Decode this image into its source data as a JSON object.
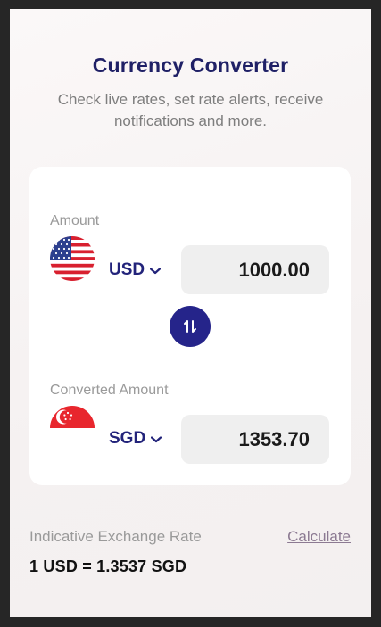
{
  "header": {
    "title": "Currency Converter",
    "subtitle": "Check live rates, set rate alerts, receive notifications and more."
  },
  "converter": {
    "from": {
      "label": "Amount",
      "currency": "USD",
      "flag": "us-flag",
      "value": "1000.00"
    },
    "to": {
      "label": "Converted Amount",
      "currency": "SGD",
      "flag": "sg-flag",
      "value": "1353.70"
    },
    "swap_icon": "swap-arrows-icon"
  },
  "rate": {
    "label": "Indicative Exchange Rate",
    "action": "Calculate",
    "value": "1 USD = 1.3537 SGD"
  },
  "colors": {
    "accent": "#25248a",
    "title": "#1f2066",
    "muted": "#9a9a9a",
    "input_bg": "#efefef"
  }
}
